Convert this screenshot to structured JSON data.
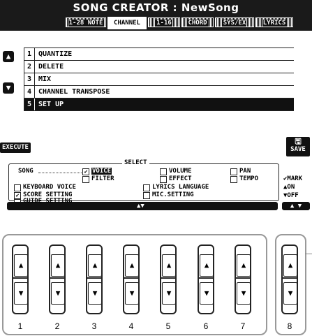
{
  "window": {
    "title": "SONG CREATOR : NewSong"
  },
  "tabs": [
    {
      "label": "1-28 NOTE",
      "active": false
    },
    {
      "label": "CHANNEL",
      "active": true
    },
    {
      "label": "1-16",
      "active": false
    },
    {
      "label": "CHORD",
      "active": false
    },
    {
      "label": "SYS/EX",
      "active": false
    },
    {
      "label": "LYRICS",
      "active": false
    }
  ],
  "nav": {
    "up_icon": "up-triangle-icon",
    "down_icon": "down-triangle-icon"
  },
  "menu": {
    "items": [
      {
        "num": "1",
        "label": "QUANTIZE",
        "selected": false
      },
      {
        "num": "2",
        "label": "DELETE",
        "selected": false
      },
      {
        "num": "3",
        "label": "MIX",
        "selected": false
      },
      {
        "num": "4",
        "label": "CHANNEL TRANSPOSE",
        "selected": false
      },
      {
        "num": "5",
        "label": "SET UP",
        "selected": true
      }
    ]
  },
  "actions": {
    "execute": "EXECUTE",
    "save": "SAVE"
  },
  "select": {
    "title": "SELECT",
    "song_label": "SONG",
    "options": {
      "voice": {
        "label": "VOICE",
        "checked": true
      },
      "volume": {
        "label": "VOLUME",
        "checked": false
      },
      "pan": {
        "label": "PAN",
        "checked": false
      },
      "filter": {
        "label": "FILTER",
        "checked": false
      },
      "effect": {
        "label": "EFFECT",
        "checked": false
      },
      "tempo": {
        "label": "TEMPO",
        "checked": false
      },
      "keyboard_voice": {
        "label": "KEYBOARD VOICE",
        "checked": false
      },
      "lyrics_language": {
        "label": "LYRICS LANGUAGE",
        "checked": false
      },
      "score_setting": {
        "label": "SCORE SETTING",
        "checked": true
      },
      "mic_setting": {
        "label": "MIC.SETTING",
        "checked": false
      },
      "guide_setting": {
        "label": "GUIDE SETTING",
        "checked": false
      }
    }
  },
  "mark": {
    "title": "✔MARK",
    "on": "▲ON",
    "off": "▼OFF"
  },
  "hardware_buttons": [
    "1",
    "2",
    "3",
    "4",
    "5",
    "6",
    "7",
    "8"
  ],
  "colors": {
    "lcd_dark": "#111111",
    "lcd_light": "#ffffff",
    "frame": "#999999"
  }
}
